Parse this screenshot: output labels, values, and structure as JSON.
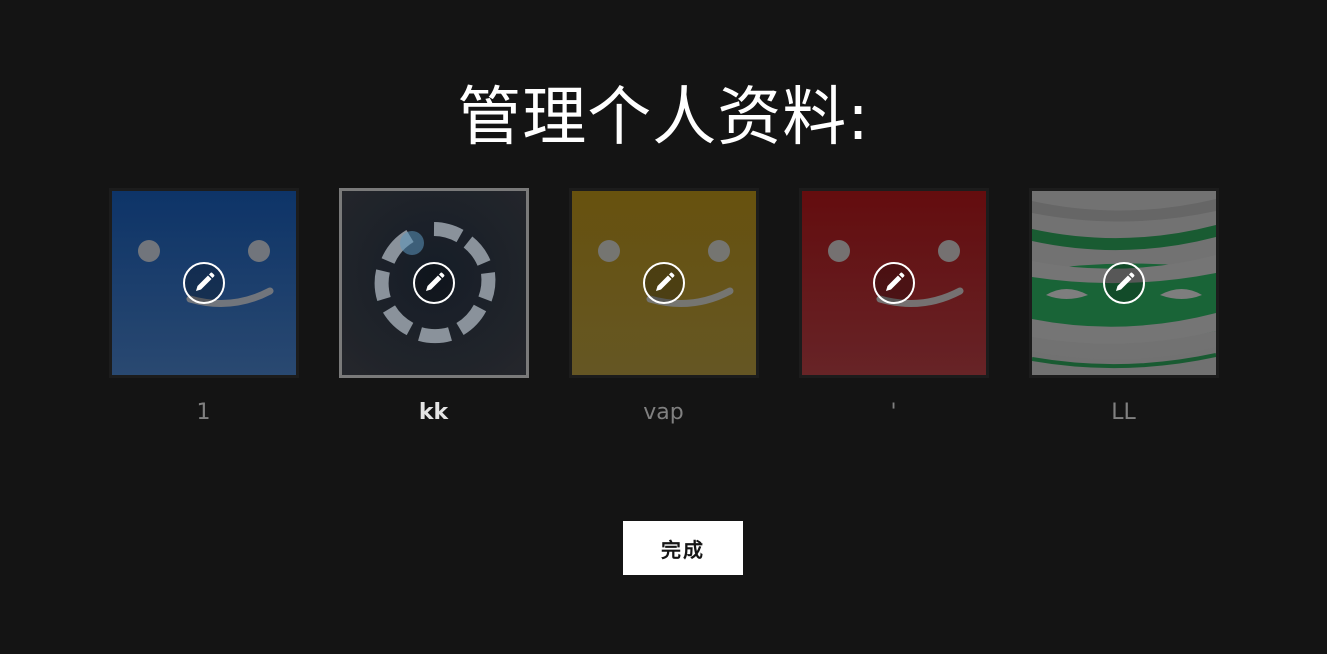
{
  "header": {
    "title": "管理个人资料:"
  },
  "profiles": [
    {
      "name": "1",
      "avatar": "smiley-blue",
      "color": "#1e4a8a",
      "selected": false
    },
    {
      "name": "kk",
      "avatar": "ring-dark",
      "color": "#2b2f38",
      "selected": true
    },
    {
      "name": "vap",
      "avatar": "smiley-yellow",
      "color": "#8a7216",
      "selected": false
    },
    {
      "name": "'",
      "avatar": "smiley-red",
      "color": "#8a1a1a",
      "selected": false
    },
    {
      "name": "LL",
      "avatar": "mummy-green",
      "color": "#1e7a40",
      "selected": false
    }
  ],
  "edit_icon": "pencil-circle-icon",
  "actions": {
    "done_label": "完成"
  },
  "colors": {
    "background": "#141414",
    "text": "#ffffff",
    "muted": "#808080"
  }
}
